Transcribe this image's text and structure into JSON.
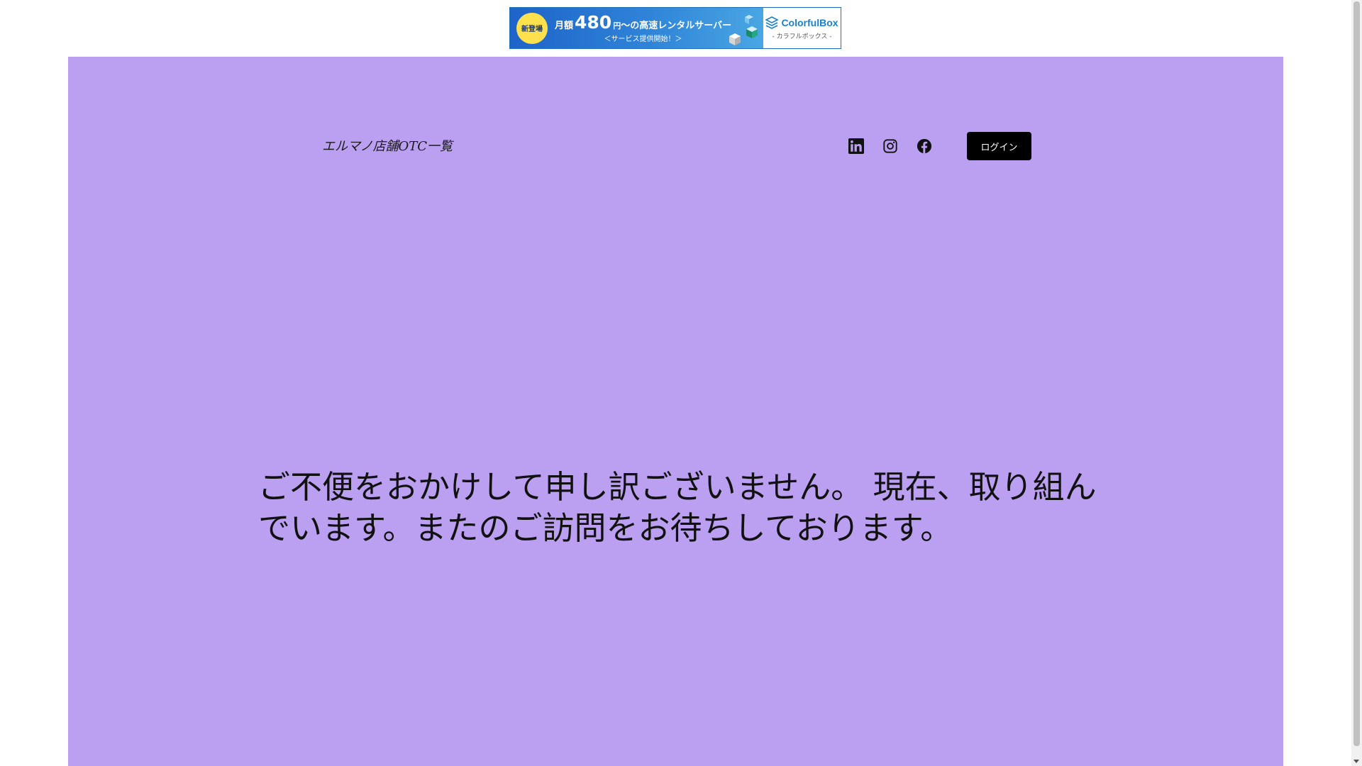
{
  "ad": {
    "badge": "新登場",
    "prefix": "月額",
    "price": "480",
    "yen": "円",
    "tagline_suffix": "〜の高速レンタルサーバー",
    "sub": "＜サービス提供開始！＞",
    "brand": "ColorfulBox",
    "brand_sub": "- カラフルボックス -"
  },
  "header": {
    "site_title": "エルマノ店舗OTC一覧",
    "login_label": "ログイン"
  },
  "social": [
    {
      "name": "linkedin-icon"
    },
    {
      "name": "instagram-icon"
    },
    {
      "name": "facebook-icon"
    }
  ],
  "main": {
    "message": "ご不便をおかけして申し訳ございません。 現在、取り組んでいます。またのご訪問をお待ちしております。"
  },
  "colors": {
    "background": "#bba0f2",
    "login_bg": "#000000",
    "ad_blue": "#1e63c9",
    "ad_badge": "#ffe14d"
  }
}
